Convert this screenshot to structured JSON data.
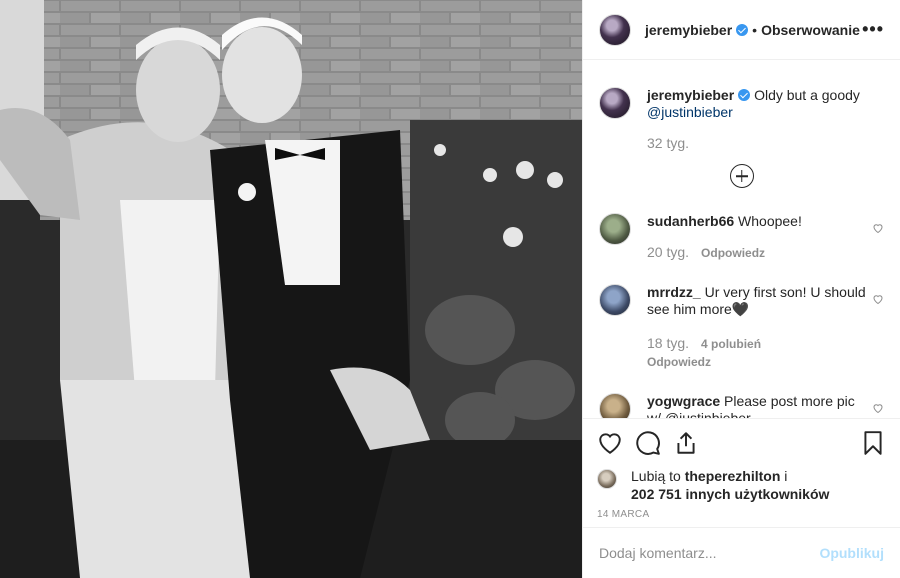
{
  "header": {
    "username": "jeremybieber",
    "separator": "•",
    "follow_label": "Obserwowanie",
    "more_label": "•••"
  },
  "caption": {
    "username": "jeremybieber",
    "text": "Oldy but a goody",
    "mention": "@justinbieber",
    "time": "32 tyg."
  },
  "comments": [
    {
      "username": "sudanherb66",
      "text": "Whoopee!",
      "time": "20 tyg.",
      "likes": "",
      "reply": "Odpowiedz"
    },
    {
      "username": "mrrdzz_",
      "text": "Ur very first son! U should see him more🖤",
      "time": "18 tyg.",
      "likes": "4 polubień",
      "reply": "Odpowiedz"
    },
    {
      "username": "yogwgrace",
      "text": "Please post more pic w/ @justinbieber",
      "time": "",
      "likes": "",
      "reply": ""
    }
  ],
  "likes": {
    "prefix": "Lubią to",
    "user": "theperezhilton",
    "connector": "i",
    "count": "202 751 innych użytkowników"
  },
  "date": "14 MARCA",
  "add_comment": {
    "placeholder": "Dodaj komentarz...",
    "post_label": "Opublikuj"
  },
  "colors": {
    "verified": "#3897f0",
    "post_disabled": "#b2dffc",
    "muted": "#8e8e8e"
  }
}
